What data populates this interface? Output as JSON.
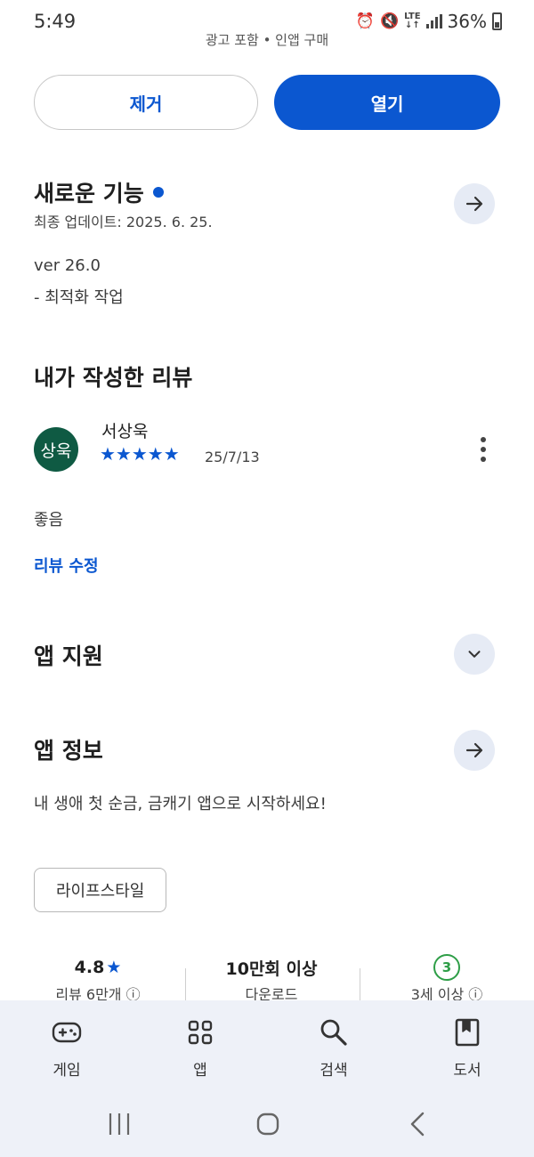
{
  "status_bar": {
    "time": "5:49",
    "network": "LTE",
    "battery": "36%",
    "icons": [
      "alarm-icon",
      "mute-icon",
      "lte-icon",
      "signal-icon",
      "battery-icon"
    ]
  },
  "ad_notice": "광고 포함 • 인앱 구매",
  "actions": {
    "remove_label": "제거",
    "open_label": "열기"
  },
  "whats_new": {
    "title": "새로운 기능",
    "updated": "최종 업데이트: 2025. 6. 25.",
    "version": "ver 26.0",
    "notes": "- 최적화 작업"
  },
  "my_review": {
    "title": "내가 작성한 리뷰",
    "avatar_text": "상욱",
    "reviewer": "서상욱",
    "rating": 5,
    "stars": "★★★★★",
    "date": "25/7/13",
    "body": "좋음",
    "edit_label": "리뷰 수정"
  },
  "app_support": {
    "title": "앱 지원"
  },
  "app_info": {
    "title": "앱 정보",
    "description": "내 생애 첫 순금, 금캐기 앱으로 시작하세요!",
    "category": "라이프스타일"
  },
  "stats": {
    "rating_value": "4.8",
    "rating_star": "★",
    "rating_label": "리뷰 6만개 ⓘ",
    "downloads_value": "10만회 이상",
    "downloads_label": "다운로드",
    "age_value": "3",
    "age_label": "3세 이상 ⓘ"
  },
  "bottom_nav": {
    "items": [
      {
        "label": "게임",
        "icon": "gamepad-icon"
      },
      {
        "label": "앱",
        "icon": "apps-grid-icon"
      },
      {
        "label": "검색",
        "icon": "search-icon"
      },
      {
        "label": "도서",
        "icon": "book-icon"
      }
    ]
  },
  "colors": {
    "accent": "#0b57d0",
    "avatar_bg": "#0f5a43",
    "age_badge": "#2e9e47",
    "nav_bg": "#eef1f8"
  }
}
